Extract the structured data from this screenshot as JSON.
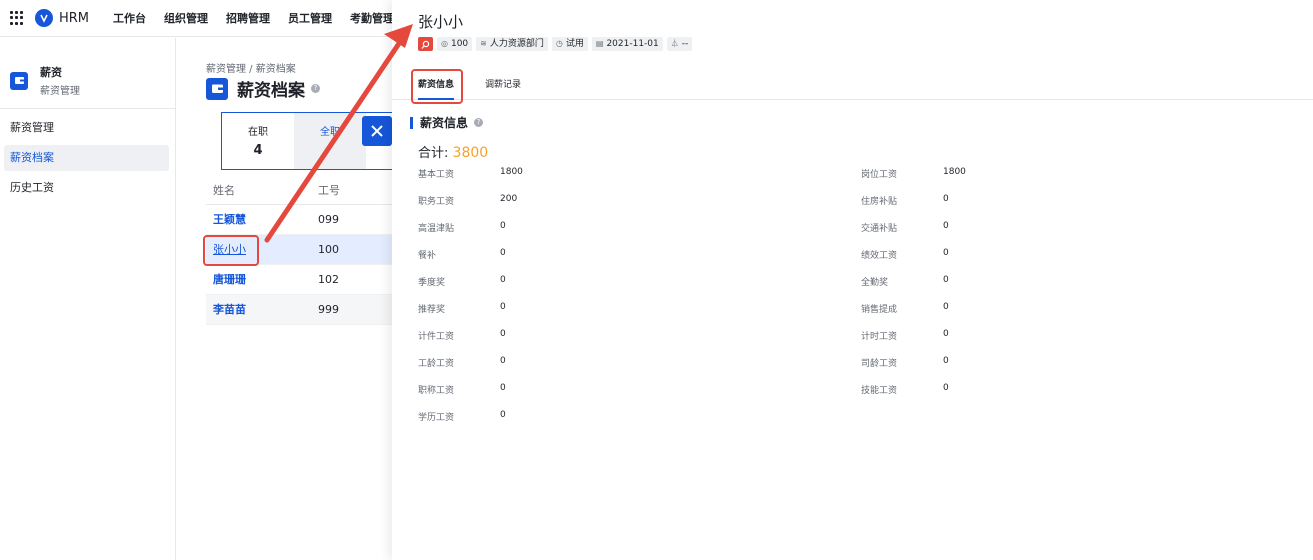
{
  "app": {
    "brand": "HRM"
  },
  "nav": [
    "工作台",
    "组织管理",
    "招聘管理",
    "员工管理",
    "考勤管理"
  ],
  "sidebar": {
    "title": "薪资",
    "subtitle": "薪资管理",
    "items": [
      {
        "label": "薪资管理",
        "active": false
      },
      {
        "label": "薪资档案",
        "active": true
      },
      {
        "label": "历史工资",
        "active": false
      }
    ]
  },
  "main": {
    "breadcrumb": "薪资管理 / 薪资档案",
    "title": "薪资档案",
    "stats": [
      {
        "label": "在职",
        "value": "4"
      },
      {
        "label": "全职",
        "value": ""
      }
    ],
    "table": {
      "headers": [
        "姓名",
        "工号"
      ],
      "rows": [
        {
          "name": "王颖慧",
          "id": "099"
        },
        {
          "name": "张小小",
          "id": "100"
        },
        {
          "name": "唐珊珊",
          "id": "102"
        },
        {
          "name": "李苗苗",
          "id": "999"
        }
      ]
    }
  },
  "panel": {
    "name": "张小小",
    "tags": [
      {
        "icon": "◎",
        "text": "100"
      },
      {
        "icon": "≋",
        "text": "人力资源部门"
      },
      {
        "icon": "◷",
        "text": "试用"
      },
      {
        "icon": "▤",
        "text": "2021-11-01"
      },
      {
        "icon": "⏃",
        "text": "--"
      }
    ],
    "tabs": [
      "薪资信息",
      "调薪记录"
    ],
    "section_title": "薪资信息",
    "total_label": "合计:",
    "total_value": "3800",
    "left_fields": [
      {
        "k": "基本工资",
        "v": "1800"
      },
      {
        "k": "职务工资",
        "v": "200"
      },
      {
        "k": "高温津贴",
        "v": "0"
      },
      {
        "k": "餐补",
        "v": "0"
      },
      {
        "k": "季度奖",
        "v": "0"
      },
      {
        "k": "推荐奖",
        "v": "0"
      },
      {
        "k": "计件工资",
        "v": "0"
      },
      {
        "k": "工龄工资",
        "v": "0"
      },
      {
        "k": "职称工资",
        "v": "0"
      },
      {
        "k": "学历工资",
        "v": "0"
      }
    ],
    "right_fields": [
      {
        "k": "岗位工资",
        "v": "1800"
      },
      {
        "k": "住房补贴",
        "v": "0"
      },
      {
        "k": "交通补贴",
        "v": "0"
      },
      {
        "k": "绩效工资",
        "v": "0"
      },
      {
        "k": "全勤奖",
        "v": "0"
      },
      {
        "k": "销售提成",
        "v": "0"
      },
      {
        "k": "计时工资",
        "v": "0"
      },
      {
        "k": "司龄工资",
        "v": "0"
      },
      {
        "k": "技能工资",
        "v": "0"
      }
    ]
  },
  "colors": {
    "accent": "#1656d9",
    "highlight": "#e5483d",
    "total": "#f7a227"
  }
}
